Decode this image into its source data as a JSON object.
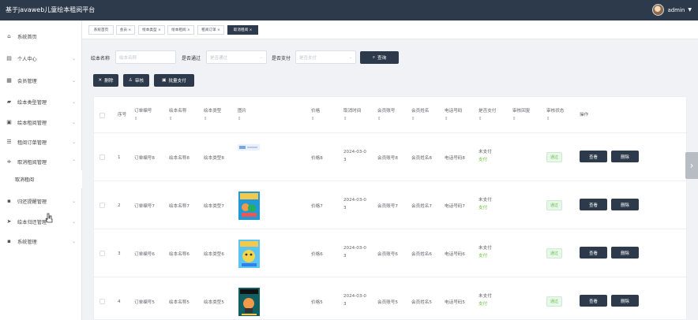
{
  "app": {
    "title": "基于javaweb儿童绘本租阅平台",
    "user": "admin"
  },
  "colors": {
    "primary": "#2d3a4b",
    "success": "#67c23a",
    "border": "#ebeef5"
  },
  "sidebar": {
    "items": [
      {
        "label": "系统首页",
        "icon": "home-icon"
      },
      {
        "label": "个人中心",
        "icon": "monitor-icon"
      },
      {
        "label": "会员管理",
        "icon": "grid-icon"
      },
      {
        "label": "绘本类型管理",
        "icon": "stack-icon"
      },
      {
        "label": "绘本租阅管理",
        "icon": "book-icon"
      },
      {
        "label": "租阅订单管理",
        "icon": "list-icon"
      },
      {
        "label": "取消租阅管理",
        "icon": "filter-icon"
      },
      {
        "label": "归还提醒管理",
        "icon": "grid-icon"
      },
      {
        "label": "绘本归还管理",
        "icon": "send-icon"
      },
      {
        "label": "系统管理",
        "icon": "grid-icon"
      }
    ],
    "subitem": "取消租阅"
  },
  "tabs": [
    {
      "label": "系统首页"
    },
    {
      "label": "会员 ×"
    },
    {
      "label": "绘本类型 ×"
    },
    {
      "label": "绘本租阅 ×"
    },
    {
      "label": "租阅订单 ×"
    },
    {
      "label": "取消租阅 ×"
    }
  ],
  "search": {
    "name_label": "绘本名称",
    "name_placeholder": "绘本名称",
    "pass_label": "是否通过",
    "pass_placeholder": "是否通过",
    "pay_label": "是否支付",
    "pay_placeholder": "是否支付",
    "query": "查询"
  },
  "actions": {
    "delete": "删除",
    "audit": "审核",
    "batch_pay": "批量支付"
  },
  "table": {
    "headers": {
      "index": "序号",
      "order_no": "订单编号",
      "book_name": "绘本名称",
      "book_type": "绘本类型",
      "image": "图片",
      "price": "价格",
      "cancel_time": "取消时间",
      "member_no": "会员账号",
      "member_name": "会员姓名",
      "phone": "电话号码",
      "paid": "是否支付",
      "audit_reply": "审核回复",
      "audit_status": "审核状态",
      "operation": "操作",
      "sort": "⇕"
    },
    "rows": [
      {
        "index": "1",
        "order_no": "订单编号8",
        "book_name": "绘本名称8",
        "book_type": "绘本类型8",
        "price": "价格8",
        "cancel_date": "2024-03-0",
        "cancel_date2": "3",
        "member_no": "会员账号8",
        "member_name": "会员姓名8",
        "phone": "电话号码8",
        "paid": "未支付",
        "pay_link": "支付",
        "audit_status": "通过",
        "view": "查看",
        "delete": "删除",
        "image_type": "banner"
      },
      {
        "index": "2",
        "order_no": "订单编号7",
        "book_name": "绘本名称7",
        "book_type": "绘本类型7",
        "price": "价格7",
        "cancel_date": "2024-03-0",
        "cancel_date2": "3",
        "member_no": "会员账号7",
        "member_name": "会员姓名7",
        "phone": "电话号码7",
        "paid": "未支付",
        "pay_link": "支付",
        "audit_status": "通过",
        "view": "查看",
        "delete": "删除",
        "image_type": "book"
      },
      {
        "index": "3",
        "order_no": "订单编号6",
        "book_name": "绘本名称6",
        "book_type": "绘本类型6",
        "price": "价格6",
        "cancel_date": "2024-03-0",
        "cancel_date2": "3",
        "member_no": "会员账号6",
        "member_name": "会员姓名6",
        "phone": "电话号码6",
        "paid": "未支付",
        "pay_link": "支付",
        "audit_status": "通过",
        "view": "查看",
        "delete": "删除",
        "image_type": "book"
      },
      {
        "index": "4",
        "order_no": "订单编号5",
        "book_name": "绘本名称5",
        "book_type": "绘本类型5",
        "price": "价格5",
        "cancel_date": "2024-03-0",
        "cancel_date2": "3",
        "member_no": "会员账号5",
        "member_name": "会员姓名5",
        "phone": "电话号码5",
        "paid": "未支付",
        "pay_link": "支付",
        "audit_status": "通过",
        "view": "查看",
        "delete": "删除",
        "image_type": "book"
      }
    ]
  }
}
